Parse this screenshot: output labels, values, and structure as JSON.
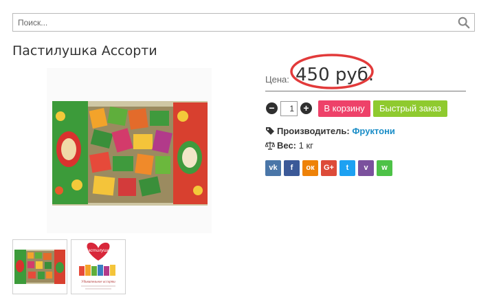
{
  "search": {
    "placeholder": "Поиск...",
    "icon": "search-icon"
  },
  "product": {
    "title": "Пастилушка Ассорти",
    "price_label": "Цена:",
    "price_value": "450 руб.",
    "quantity": "1",
    "add_to_cart_label": "В корзину",
    "quick_order_label": "Быстрый заказ",
    "manufacturer_label": "Производитель:",
    "manufacturer_value": "Фруктони",
    "weight_label": "Вес:",
    "weight_value": "1 кг"
  },
  "thumb2": {
    "brand_text": "Пастилушка",
    "caption": "Удивительное ассорти"
  },
  "colors": {
    "cart_button": "#ee4169",
    "quick_order_button": "#8fca2f",
    "link": "#1a8dc7",
    "price_circle": "#e23a3a"
  },
  "social": [
    {
      "name": "vk",
      "icon": "vk-icon",
      "glyph": "vk",
      "color": "#4a76a8"
    },
    {
      "name": "facebook",
      "icon": "facebook-icon",
      "glyph": "f",
      "color": "#3b5998"
    },
    {
      "name": "odnoklassniki",
      "icon": "odnoklassniki-icon",
      "glyph": "ок",
      "color": "#ee8208"
    },
    {
      "name": "google-plus",
      "icon": "google-plus-icon",
      "glyph": "G+",
      "color": "#dd4b39"
    },
    {
      "name": "twitter",
      "icon": "twitter-icon",
      "glyph": "t",
      "color": "#1da1f2"
    },
    {
      "name": "viber",
      "icon": "viber-icon",
      "glyph": "v",
      "color": "#7b519d"
    },
    {
      "name": "whatsapp",
      "icon": "whatsapp-icon",
      "glyph": "w",
      "color": "#4dc247"
    }
  ]
}
